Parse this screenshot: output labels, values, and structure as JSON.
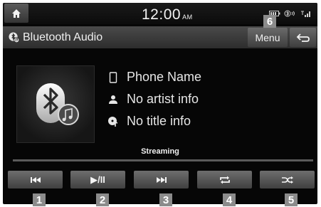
{
  "status_bar": {
    "time": "12:00",
    "ampm": "AM",
    "icons": [
      "battery-icon",
      "bluetooth-signal-icon",
      "cellular-signal-icon"
    ]
  },
  "title_bar": {
    "title": "Bluetooth Audio",
    "menu_label": "Menu"
  },
  "track": {
    "device": "Phone Name",
    "artist": "No artist info",
    "title": "No title info"
  },
  "playback": {
    "status": "Streaming",
    "progress": 0
  },
  "controls": [
    {
      "name": "previous-button",
      "icon": "previous-track-icon",
      "glyph": "⏮"
    },
    {
      "name": "play-pause-button",
      "icon": "play-pause-icon",
      "glyph": "▶/II"
    },
    {
      "name": "next-button",
      "icon": "next-track-icon",
      "glyph": "⏭"
    },
    {
      "name": "repeat-button",
      "icon": "repeat-icon",
      "glyph": ""
    },
    {
      "name": "shuffle-button",
      "icon": "shuffle-icon",
      "glyph": "⤮"
    }
  ],
  "callouts": [
    "1",
    "2",
    "3",
    "4",
    "5",
    "6"
  ]
}
